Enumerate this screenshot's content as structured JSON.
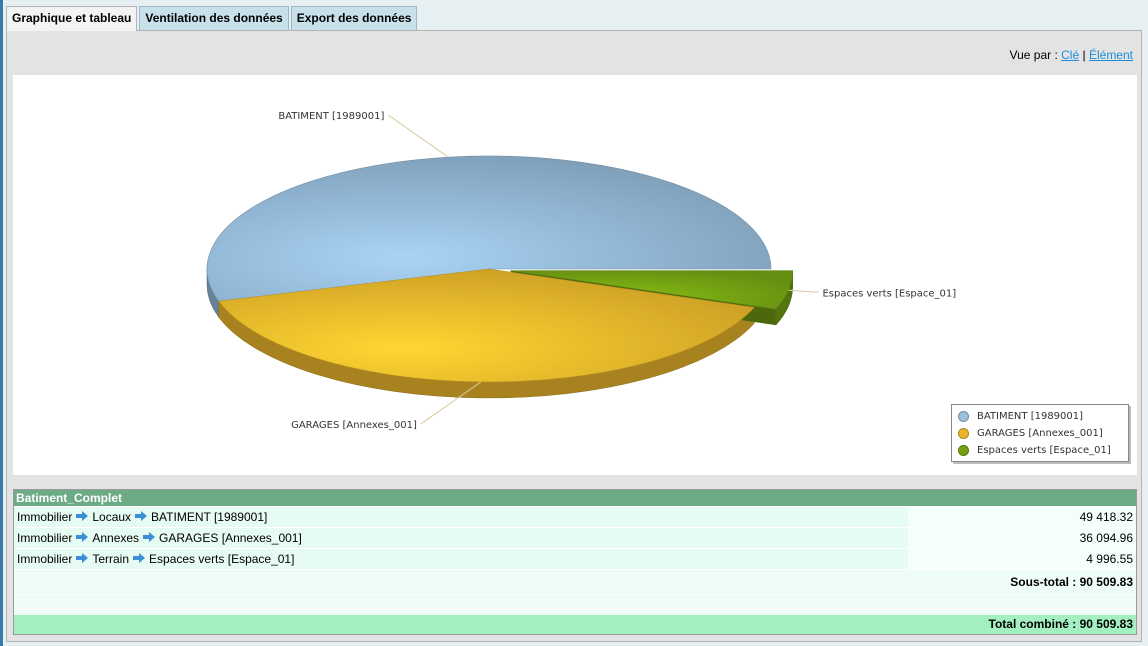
{
  "tabs": [
    {
      "label": "Graphique et tableau",
      "active": true
    },
    {
      "label": "Ventilation des données",
      "active": false
    },
    {
      "label": "Export des données",
      "active": false
    }
  ],
  "view_by": {
    "label": "Vue par :",
    "key_link": "Clé",
    "separator": "|",
    "element_link": "Élément"
  },
  "chart_data": {
    "type": "pie",
    "style": "3d",
    "slices": [
      {
        "label": "BATIMENT [1989001]",
        "value": 49418.32,
        "color": "#8fb3d0"
      },
      {
        "label": "GARAGES [Annexes_001]",
        "value": 36094.96,
        "color": "#e8b52a"
      },
      {
        "label": "Espaces verts [Espace_01]",
        "value": 4996.55,
        "color": "#74a213"
      }
    ],
    "legend_position": "bottom-right"
  },
  "table": {
    "group_title": "Batiment_Complet",
    "rows": [
      {
        "path": [
          "Immobilier",
          "Locaux",
          "BATIMENT [1989001]"
        ],
        "amount": "49 418.32"
      },
      {
        "path": [
          "Immobilier",
          "Annexes",
          "GARAGES [Annexes_001]"
        ],
        "amount": "36 094.96"
      },
      {
        "path": [
          "Immobilier",
          "Terrain",
          "Espaces verts [Espace_01]"
        ],
        "amount": "4 996.55"
      }
    ],
    "subtotal": "Sous-total : 90 509.83",
    "total": "Total combiné : 90 509.83"
  },
  "icons": {
    "path_separator": "arrow-right-icon"
  }
}
